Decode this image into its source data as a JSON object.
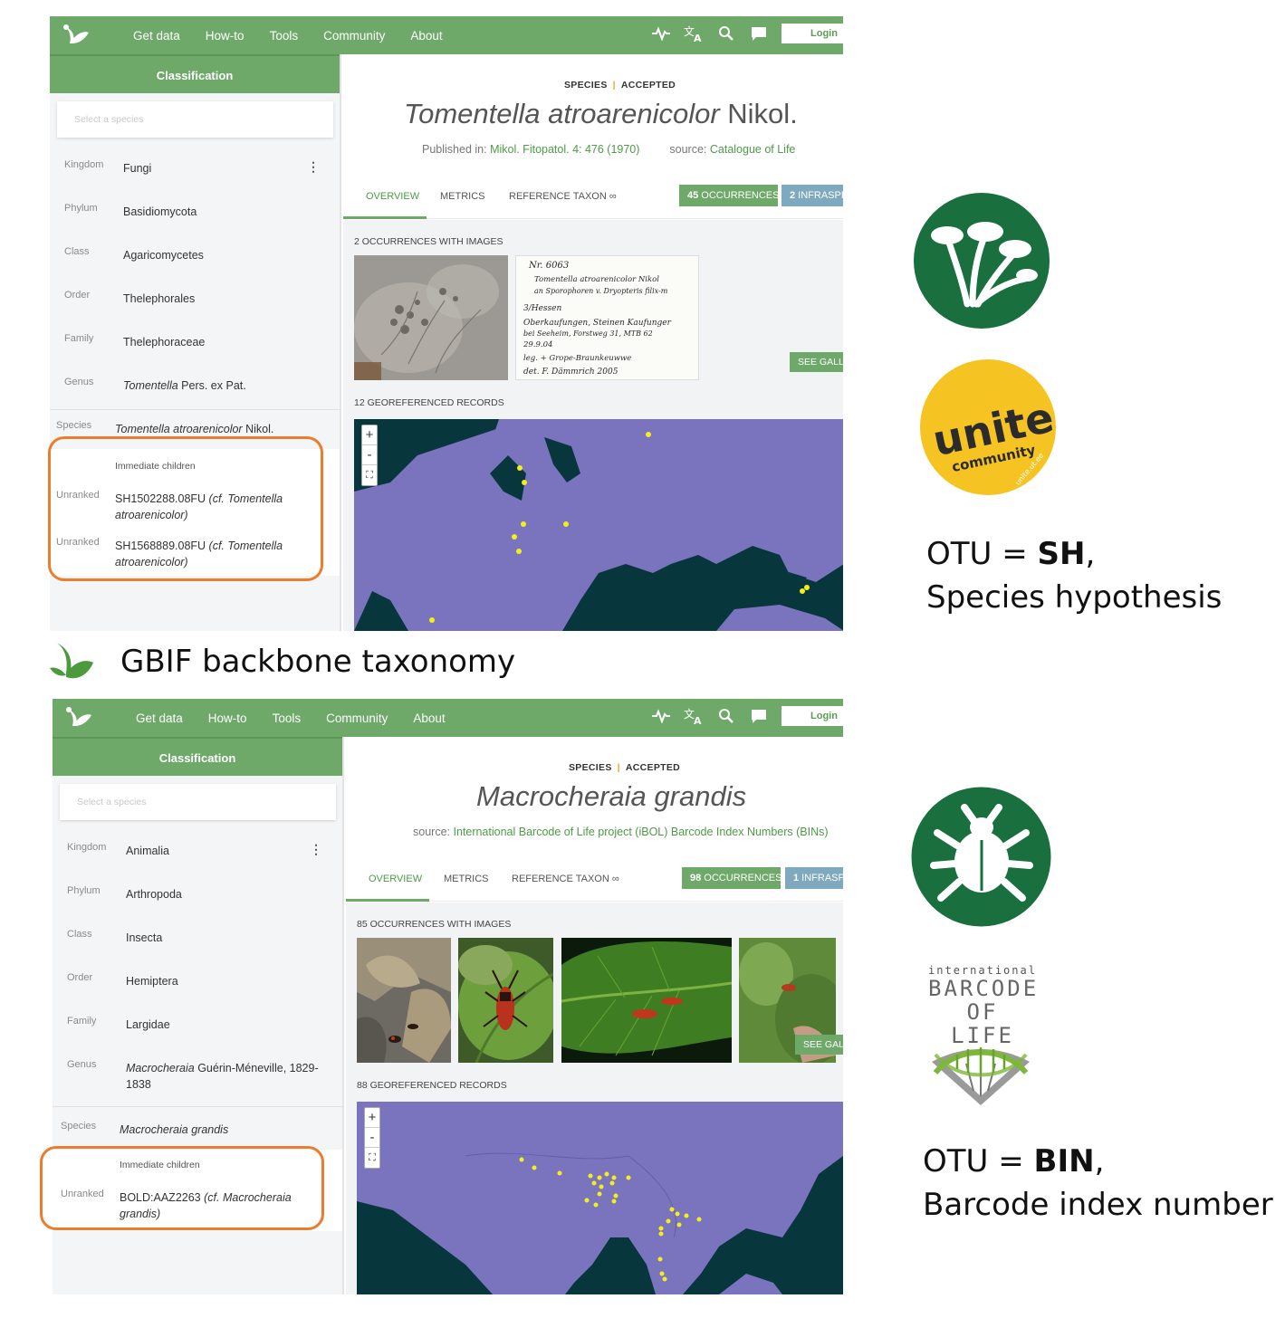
{
  "colors": {
    "gbif_green": "#6fa96a",
    "occurrence_green": "#6fa96a",
    "infraspecies_blue": "#7fa9be",
    "highlight_orange": "#ea7d2e",
    "unite_yellow": "#f5c322",
    "icon_dark_green": "#1a6f3e",
    "map_sea": "#07363c",
    "map_land": "#7a74be",
    "record_dot": "#f4ef1a"
  },
  "nav": {
    "links": [
      "Get data",
      "How-to",
      "Tools",
      "Community",
      "About"
    ],
    "icons": [
      "activity-icon",
      "translate-icon",
      "search-icon",
      "chat-icon"
    ],
    "login": "Login"
  },
  "panels": [
    {
      "classification_title": "Classification",
      "search_placeholder": "Select a species",
      "ranks": [
        {
          "label": "Kingdom",
          "value": "Fungi"
        },
        {
          "label": "Phylum",
          "value": "Basidiomycota"
        },
        {
          "label": "Class",
          "value": "Agaricomycetes"
        },
        {
          "label": "Order",
          "value": "Thelephorales"
        },
        {
          "label": "Family",
          "value": "Thelephoraceae"
        },
        {
          "label": "Genus",
          "value_italic": "Tomentella",
          "value_rest": " Pers. ex Pat."
        }
      ],
      "species": {
        "label": "Species",
        "value_italic": "Tomentella atroarenicolor",
        "value_rest": " Nikol."
      },
      "children_title": "Immediate children",
      "children": [
        {
          "label": "Unranked",
          "value": "SH1502288.08FU (cf. Tomentella atroarenicolor)"
        },
        {
          "label": "Unranked",
          "value": "SH1568889.08FU (cf. Tomentella atroarenicolor)"
        }
      ],
      "status_rank": "SPECIES",
      "status_state": "ACCEPTED",
      "title_italic": "Tomentella atroarenicolor",
      "title_author": " Nikol.",
      "published_prefix": "Published in: ",
      "published_link": "Mikol. Fitopatol. 4: 476 (1970)",
      "source_prefix": "source: ",
      "source_link": "Catalogue of Life",
      "tabs": [
        "OVERVIEW",
        "METRICS",
        "REFERENCE TAXON ∞"
      ],
      "occurrences_btn": {
        "count": "45",
        "label": " OCCURRENCES"
      },
      "infraspecies_btn": {
        "count": "2",
        "label": " INFRASPE"
      },
      "images_label": "2 OCCURRENCES WITH IMAGES",
      "see_gallery": "SEE GALLE",
      "georef_label": "12 GEOREFERENCED RECORDS",
      "map_zoom_in": "+",
      "map_zoom_out": "-",
      "map_fullscreen": "⛶",
      "specimen_label_lines": [
        "Nr. 6063",
        "Tomentella atroarenicolor Nikol",
        "an Sporophoren v. Dryopteris filix-m",
        "3/Hessen",
        "Oberkaufungen, Steinen Kaufunger",
        "bei Seeheim, Forstweg 31, MTB 62",
        "29.9.04",
        "leg. + Grope-Braunkeuwwe",
        "det. F. Dämmrich   2005"
      ]
    },
    {
      "classification_title": "Classification",
      "search_placeholder": "Select a species",
      "ranks": [
        {
          "label": "Kingdom",
          "value": "Animalia"
        },
        {
          "label": "Phylum",
          "value": "Arthropoda"
        },
        {
          "label": "Class",
          "value": "Insecta"
        },
        {
          "label": "Order",
          "value": "Hemiptera"
        },
        {
          "label": "Family",
          "value": "Largidae"
        },
        {
          "label": "Genus",
          "value_italic": "Macrocheraia",
          "value_rest": " Guérin-Méneville, 1829-1838"
        }
      ],
      "species": {
        "label": "Species",
        "value_italic": "Macrocheraia grandis",
        "value_rest": ""
      },
      "children_title": "Immediate children",
      "children": [
        {
          "label": "Unranked",
          "value": "BOLD:AAZ2263 (cf. Macrocheraia grandis)"
        }
      ],
      "status_rank": "SPECIES",
      "status_state": "ACCEPTED",
      "title_italic": "Macrocheraia grandis",
      "title_author": "",
      "source_prefix": "source: ",
      "source_link": "International Barcode of Life project (iBOL) Barcode Index Numbers (BINs)",
      "tabs": [
        "OVERVIEW",
        "METRICS",
        "REFERENCE TAXON ∞"
      ],
      "occurrences_btn": {
        "count": "98",
        "label": " OCCURRENCES"
      },
      "infraspecies_btn": {
        "count": "1",
        "label": " INFRASP"
      },
      "images_label": "85 OCCURRENCES WITH IMAGES",
      "see_gallery": "SEE GALL",
      "georef_label": "88 GEOREFERENCED RECORDS",
      "map_zoom_in": "+",
      "map_zoom_out": "-",
      "map_fullscreen": "⛶"
    }
  ],
  "caption": "GBIF backbone taxonomy",
  "unite_logo": {
    "word": "unite",
    "sub": "community",
    "url": "unite.ut.ee"
  },
  "ibol_logo": {
    "line1": "international",
    "line2": "BARCODE",
    "line3": "OF LIFE"
  },
  "otu_sh": {
    "prefix": "OTU = ",
    "bold": "SH",
    "suffix": ",",
    "line2": "Species hypothesis"
  },
  "otu_bin": {
    "prefix": "OTU = ",
    "bold": "BIN",
    "suffix": ",",
    "line2": "Barcode index number"
  }
}
